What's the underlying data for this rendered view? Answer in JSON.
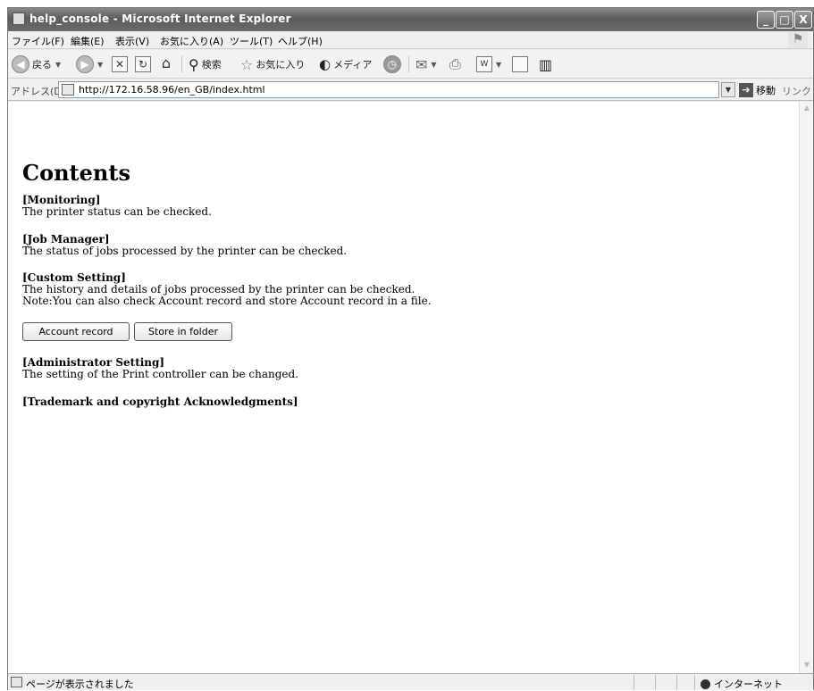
{
  "window": {
    "title": "help_console - Microsoft Internet Explorer",
    "controls": {
      "minimize": "_",
      "maximize": "□",
      "close": "X"
    }
  },
  "menu": {
    "items": [
      "ファイル(F)",
      "編集(E)",
      "表示(V)",
      "お気に入り(A)",
      "ツール(T)",
      "ヘルプ(H)"
    ]
  },
  "toolbar": {
    "back_label": "戻る",
    "search_label": "検索",
    "favorites_label": "お気に入り",
    "media_label": "メディア"
  },
  "address": {
    "label": "アドレス(D)",
    "url": "http://172.16.58.96/en_GB/index.html",
    "go_label": "移動",
    "links_label": "リンク »"
  },
  "content": {
    "title": "Contents",
    "sections": [
      {
        "heading": "[Monitoring]",
        "lines": [
          "The printer status can be checked."
        ]
      },
      {
        "heading": "[Job Manager]",
        "lines": [
          "The status of jobs processed by the printer can be checked."
        ]
      },
      {
        "heading": "[Custom Setting]",
        "lines": [
          "The history and details of jobs processed by the printer can be checked.",
          "Note:You can also check Account record and store Account record in a file."
        ]
      },
      {
        "heading": "[Administrator Setting]",
        "lines": [
          "The setting of the Print controller can be changed."
        ]
      },
      {
        "heading": "[Trademark and copyright Acknowledgments]",
        "lines": []
      }
    ],
    "buttons": {
      "account_record": "Account record",
      "store_in_folder": "Store in folder"
    }
  },
  "status": {
    "text": "ページが表示されました",
    "zone": "インターネット"
  },
  "icons": [
    "app-icon",
    "back-icon",
    "forward-icon",
    "stop-icon",
    "refresh-icon",
    "home-icon",
    "search-icon",
    "favorites-star-icon",
    "media-icon",
    "history-icon",
    "mail-icon",
    "print-icon",
    "edit-icon",
    "discuss-icon",
    "messenger-icon",
    "page-icon",
    "go-arrow-icon",
    "globe-icon"
  ]
}
